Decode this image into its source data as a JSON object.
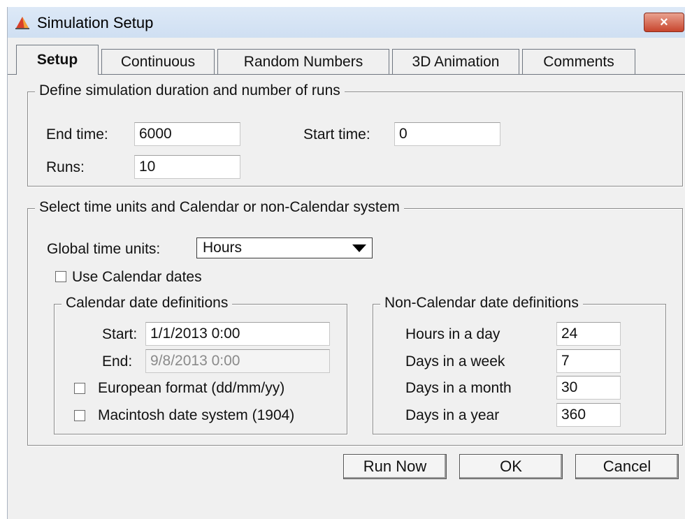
{
  "window": {
    "title": "Simulation Setup",
    "close_label": "×"
  },
  "tabs": [
    {
      "label": "Setup"
    },
    {
      "label": "Continuous"
    },
    {
      "label": "Random Numbers"
    },
    {
      "label": "3D Animation"
    },
    {
      "label": "Comments"
    }
  ],
  "duration": {
    "legend": "Define simulation duration and number of runs",
    "end_time_label": "End time:",
    "end_time_value": "6000",
    "start_time_label": "Start time:",
    "start_time_value": "0",
    "runs_label": "Runs:",
    "runs_value": "10"
  },
  "units": {
    "legend": "Select time units and Calendar or non-Calendar system",
    "global_label": "Global time units:",
    "global_value": "Hours",
    "use_calendar_label": "Use Calendar dates",
    "use_calendar_checked": false
  },
  "calendar": {
    "legend": "Calendar date definitions",
    "start_label": "Start:",
    "start_value": "1/1/2013 0:00",
    "end_label": "End:",
    "end_value": "9/8/2013 0:00",
    "european_label": "European format (dd/mm/yy)",
    "european_checked": false,
    "mac_label": "Macintosh date system (1904)",
    "mac_checked": false
  },
  "noncalendar": {
    "legend": "Non-Calendar date definitions",
    "hours_day_label": "Hours in a day",
    "hours_day_value": "24",
    "days_week_label": "Days in a week",
    "days_week_value": "7",
    "days_month_label": "Days in a month",
    "days_month_value": "30",
    "days_year_label": "Days in a year",
    "days_year_value": "360"
  },
  "buttons": {
    "run_now": "Run Now",
    "ok": "OK",
    "cancel": "Cancel"
  },
  "colors": {
    "title_bar": "#d6e4f5",
    "close_button": "#c8452d",
    "dialog_bg": "#f0f0f0"
  }
}
